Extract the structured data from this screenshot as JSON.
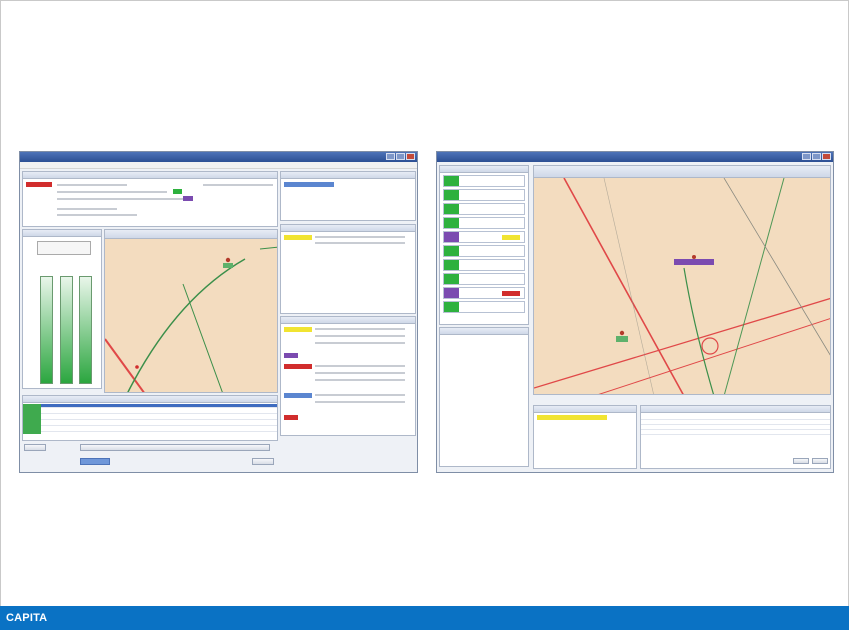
{
  "footer": {
    "brand": "CAPITA"
  },
  "colors": {
    "footer_bar": "#0a72c4",
    "window_title": "#2c4f93",
    "map_background": "#f3dcbf",
    "road_red": "#e04848",
    "road_green": "#3b8f4a",
    "status_red": "#d12d2d",
    "status_yellow": "#f1e431",
    "status_purple": "#7b4bb0",
    "status_green": "#2eb13e"
  },
  "icons": {
    "map_marker": "incident-marker-icon",
    "window_controls": "window-control-icons"
  }
}
